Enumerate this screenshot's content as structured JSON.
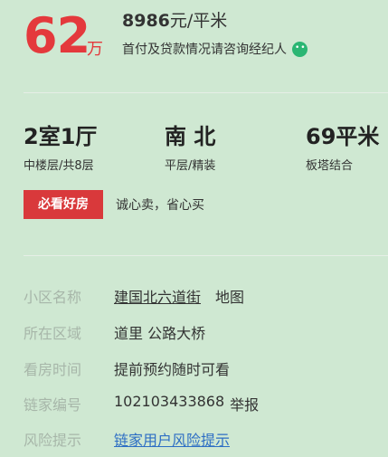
{
  "price": {
    "total": "62",
    "unit": "万",
    "per_sqm_value": "8986",
    "per_sqm_unit": "元/平米",
    "payment_note": "首付及贷款情况请咨询经纪人"
  },
  "attributes": [
    {
      "main": "2室1厅",
      "sub": "中楼层/共8层"
    },
    {
      "main": "南 北",
      "sub": "平层/精装"
    },
    {
      "main": "69平米",
      "sub": "板塔结合"
    }
  ],
  "tag": {
    "label": "必看好房",
    "text": "诚心卖，省心买"
  },
  "info": {
    "community": {
      "label": "小区名称",
      "value": "建国北六道街",
      "extra": "地图"
    },
    "area": {
      "label": "所在区域",
      "value": "道里 公路大桥"
    },
    "viewing": {
      "label": "看房时间",
      "value": "提前预约随时可看"
    },
    "code": {
      "label": "链家编号",
      "value": "102103433868",
      "extra": "举报"
    },
    "risk": {
      "label": "风险提示",
      "value": "链家用户风险提示"
    }
  },
  "colors": {
    "price_red": "#e4393c",
    "tag_red": "#d9393b",
    "link_blue": "#2d6ec4",
    "background": "#cfe8d2",
    "wechat_green": "#2bb673"
  }
}
